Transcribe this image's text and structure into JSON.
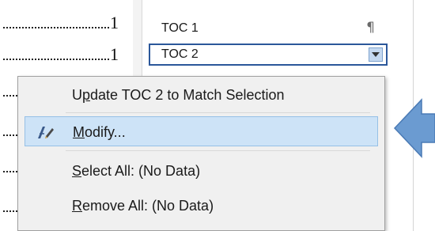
{
  "document": {
    "toc_page_numbers": [
      "1",
      "1"
    ]
  },
  "styles_pane": {
    "items": [
      {
        "label": "TOC 1",
        "mark": "¶"
      },
      {
        "label": "TOC 2",
        "dropdown_icon": "dropdown-arrow-icon"
      }
    ]
  },
  "context_menu": {
    "items": [
      {
        "pre": "U",
        "key": "p",
        "post": "date TOC 2 to Match Selection"
      },
      {
        "pre": "",
        "key": "M",
        "post": "odify...",
        "icon": "modify-style-icon"
      },
      {
        "pre": "",
        "key": "S",
        "post": "elect All: (No Data)"
      },
      {
        "pre": "",
        "key": "R",
        "post": "emove All: (No Data)"
      }
    ]
  },
  "annotation": {
    "arrow_icon": "pointer-arrow-icon",
    "color": "#6b9bd1"
  }
}
